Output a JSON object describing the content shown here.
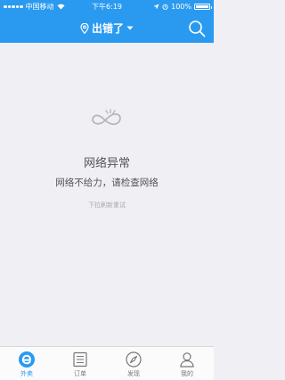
{
  "colors": {
    "brand": "#2a9af0",
    "background": "#efeff4",
    "tab_inactive": "#777777"
  },
  "status_bar": {
    "carrier": "中国移动",
    "time": "下午6:19",
    "battery": "100%"
  },
  "header": {
    "location_label": "出错了",
    "location_icon": "location-pin-icon",
    "dropdown_icon": "caret-down-icon",
    "search_icon": "search-icon"
  },
  "error": {
    "icon": "network-error-icon",
    "title": "网络异常",
    "message": "网络不给力，请检查网络",
    "hint": "下拉刷新重试"
  },
  "tabs": [
    {
      "label": "外卖",
      "icon": "takeout-e-icon",
      "active": true
    },
    {
      "label": "订单",
      "icon": "order-list-icon",
      "active": false
    },
    {
      "label": "发现",
      "icon": "compass-icon",
      "active": false
    },
    {
      "label": "我的",
      "icon": "user-icon",
      "active": false
    }
  ]
}
